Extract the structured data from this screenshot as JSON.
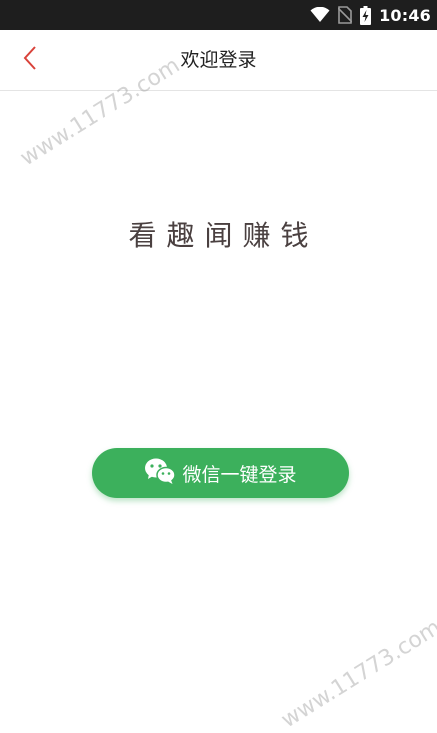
{
  "status_bar": {
    "time": "10:46",
    "icons": [
      "wifi-icon",
      "no-sim-icon",
      "battery-charging-icon"
    ]
  },
  "nav": {
    "back_icon": "chevron-left-icon",
    "title": "欢迎登录"
  },
  "main": {
    "slogan": "看趣闻赚钱",
    "wechat_button": {
      "icon": "wechat-icon",
      "label": "微信一键登录"
    }
  },
  "watermark": "www.11773.com",
  "colors": {
    "accent": "#3cb05c",
    "back_icon": "#d9423a",
    "status_bar": "#1e1e1e"
  }
}
